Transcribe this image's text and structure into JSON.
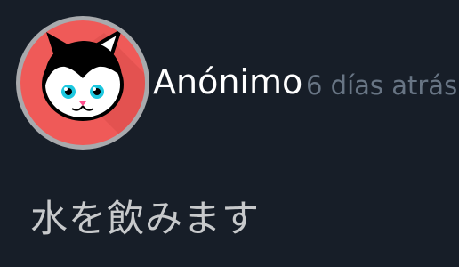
{
  "post": {
    "author": "Anónimo",
    "timestamp": "6 días atrás",
    "message": "水を飲みます",
    "avatar": {
      "icon": "cat-face-icon",
      "ring_color": "#a8aaad",
      "background_color": "#ef5a58"
    }
  },
  "colors": {
    "page_background": "#171e28",
    "author_text": "#ffffff",
    "timestamp_text": "#687584",
    "message_text": "#c7c9cb"
  }
}
